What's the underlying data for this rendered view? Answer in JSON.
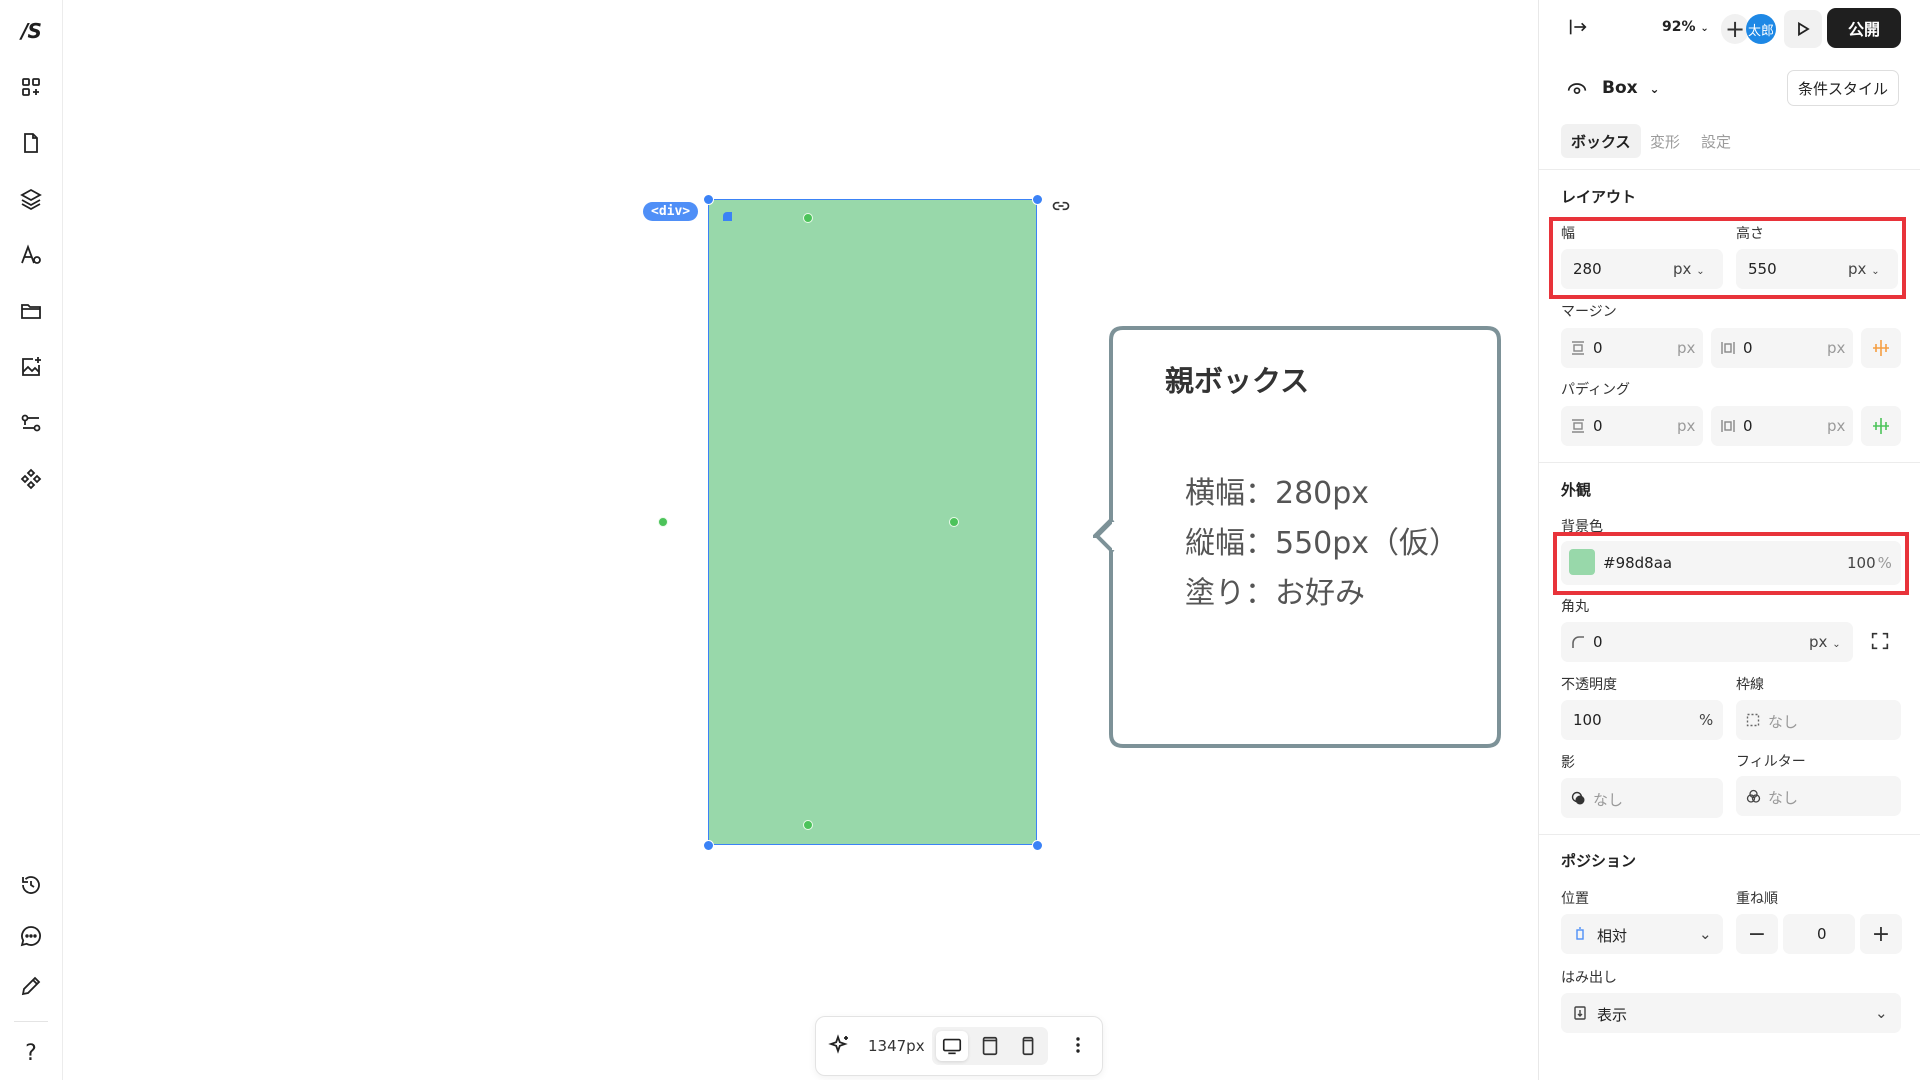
{
  "app": {
    "logo_text": "/S"
  },
  "rail": {
    "items": [
      "components",
      "pages",
      "layers",
      "typography",
      "folders",
      "images",
      "flows",
      "assets",
      "history",
      "comments",
      "edit"
    ],
    "help": "?"
  },
  "canvas": {
    "element_tag": "<div>",
    "callout": {
      "title": "親ボックス",
      "lines": [
        "横幅：280px",
        "縦幅：550px（仮）",
        "塗り：お好み"
      ]
    },
    "box_color": "#98d8aa"
  },
  "bottombar": {
    "width_label": "1347px"
  },
  "panel": {
    "zoom": "92%",
    "avatar": "太郎",
    "publish": "公開",
    "element_name": "Box",
    "conditional_style": "条件スタイル",
    "tabs": [
      "ボックス",
      "変形",
      "設定"
    ],
    "layout": {
      "title": "レイアウト",
      "width_label": "幅",
      "width_value": "280",
      "width_unit": "px",
      "height_label": "高さ",
      "height_value": "550",
      "height_unit": "px",
      "margin_label": "マージン",
      "margin_v": "0",
      "margin_h": "0",
      "margin_unit": "px",
      "padding_label": "パディング",
      "padding_v": "0",
      "padding_h": "0",
      "padding_unit": "px"
    },
    "appearance": {
      "title": "外観",
      "bg_label": "背景色",
      "bg_hex": "#98d8aa",
      "bg_opacity": "100",
      "bg_opacity_unit": "%",
      "radius_label": "角丸",
      "radius_value": "0",
      "radius_unit": "px",
      "opacity_label": "不透明度",
      "opacity_value": "100",
      "opacity_unit": "%",
      "border_label": "枠線",
      "border_value": "なし",
      "shadow_label": "影",
      "shadow_value": "なし",
      "filter_label": "フィルター",
      "filter_value": "なし"
    },
    "position": {
      "title": "ポジション",
      "pos_label": "位置",
      "pos_value": "相対",
      "z_label": "重ね順",
      "z_value": "0",
      "z_minus": "−",
      "z_plus": "+",
      "overflow_label": "はみ出し",
      "overflow_value": "表示"
    }
  }
}
